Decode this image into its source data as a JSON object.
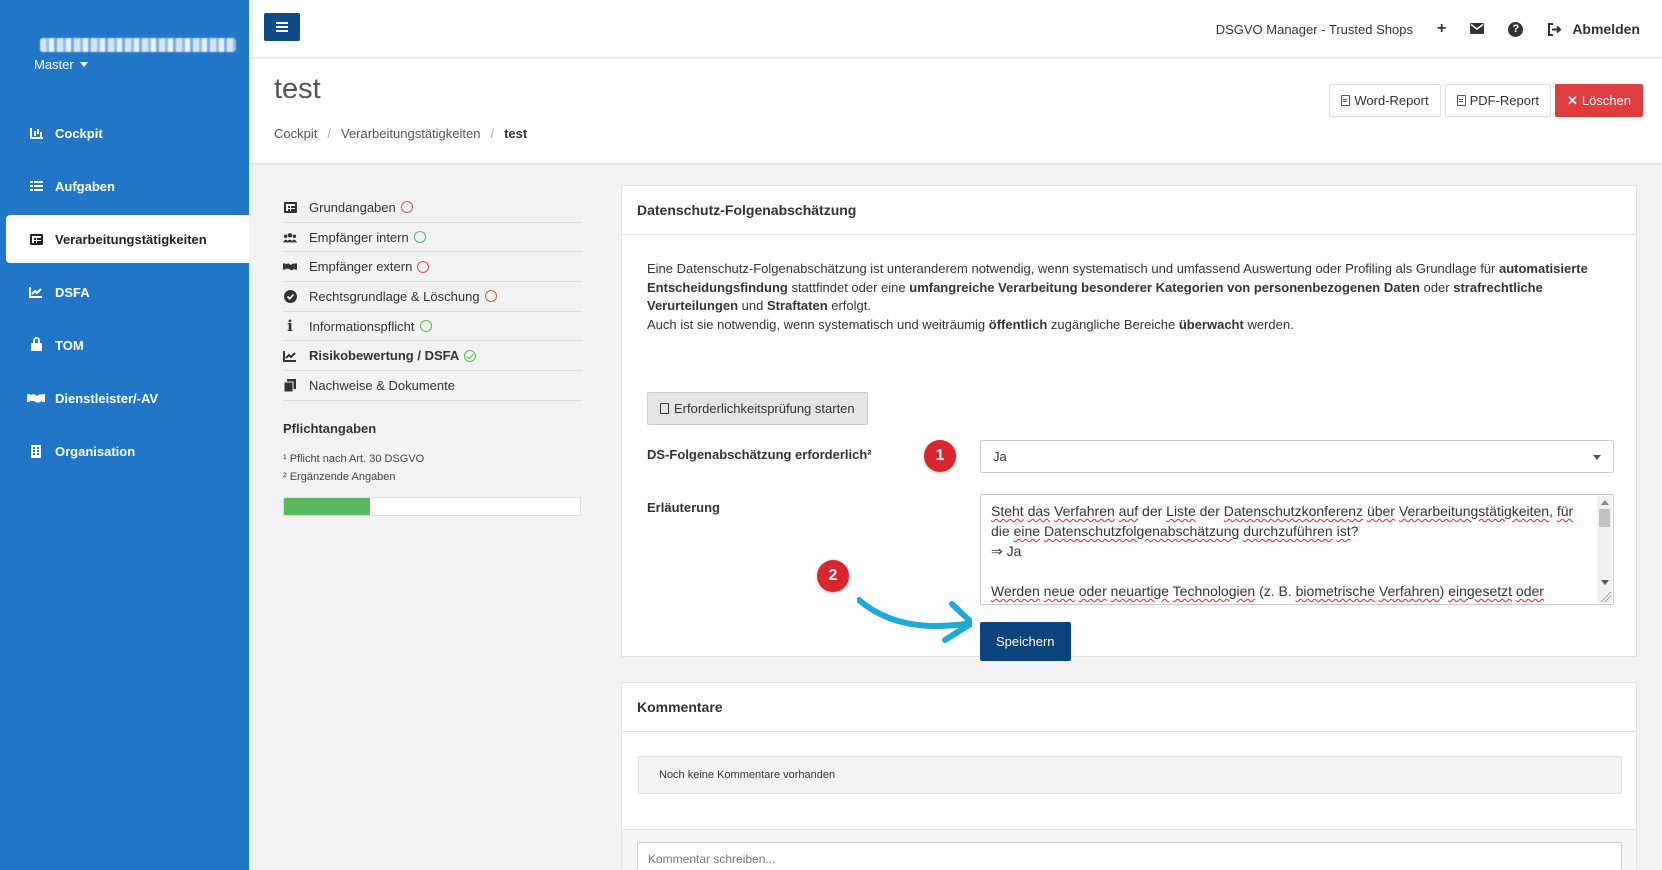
{
  "sidebar": {
    "user_label": "",
    "tenant": "Master",
    "items": [
      {
        "label": "Cockpit",
        "icon": "chart-icon"
      },
      {
        "label": "Aufgaben",
        "icon": "list-icon"
      },
      {
        "label": "Verarbeitungstätigkeiten",
        "icon": "table-icon",
        "active": true
      },
      {
        "label": "DSFA",
        "icon": "line-chart-icon"
      },
      {
        "label": "TOM",
        "icon": "lock-icon"
      },
      {
        "label": "Dienstleister/-AV",
        "icon": "handshake-icon"
      },
      {
        "label": "Organisation",
        "icon": "building-icon"
      }
    ]
  },
  "topbar": {
    "app_name": "DSGVO Manager - Trusted Shops",
    "logout_label": "Abmelden"
  },
  "header": {
    "title": "test",
    "breadcrumb": [
      "Cockpit",
      "Verarbeitungstätigkeiten",
      "test"
    ],
    "word_report_label": "Word-Report",
    "pdf_report_label": "PDF-Report",
    "delete_label": "Löschen"
  },
  "tabs": [
    {
      "label": "Grundangaben",
      "status": "red"
    },
    {
      "label": "Empfänger intern",
      "status": "green"
    },
    {
      "label": "Empfänger extern",
      "status": "red"
    },
    {
      "label": "Rechtsgrundlage & Löschung",
      "status": "red"
    },
    {
      "label": "Informationspflicht",
      "status": "green"
    },
    {
      "label": "Risikobewertung / DSFA",
      "status": "check"
    },
    {
      "label": "Nachweise & Dokumente",
      "status": "none"
    }
  ],
  "pflicht": {
    "title": "Pflichtangaben",
    "footnote1": "¹ Pflicht nach Art. 30 DSGVO",
    "footnote2": "² Ergänzende Angaben",
    "progress_fraction": 0.29
  },
  "dsfa": {
    "title": "Datenschutz-Folgenabschätzung",
    "intro": {
      "p1": "Eine Datenschutz-Folgenabschätzung ist unteranderem notwendig, wenn systematisch und umfassend Auswertung oder Profiling als Grundlage für ",
      "b1": "automatisierte Entscheidungsfindung",
      "p2": " stattfindet oder eine ",
      "b2": "umfangreiche Verarbeitung besonderer Kategorien von personenbezogenen Daten",
      "p3": " oder ",
      "b3": "strafrechtliche Verurteilungen",
      "p4": " und ",
      "b4": "Straftaten",
      "p5": " erfolgt.",
      "p6": "Auch ist sie notwendig, wenn systematisch und weiträumig ",
      "b5": "öffentlich",
      "p7": " zugängliche Bereiche ",
      "b6": "überwacht",
      "p8": " werden."
    },
    "check_button_label": "Erforderlichkeitsprüfung starten",
    "required_label": "DS-Folgenabschätzung erforderlich²",
    "required_value": "Ja",
    "explanation_label": "Erläuterung",
    "explanation_text": {
      "q1": "Steht das Verfahren auf der Liste der Datenschutzkonferenz über Verarbeitungstätigkeiten, für die eine Datenschutzfolgenabschätzung durchzuführen ist?",
      "a1": "⇒ Ja",
      "q2": "Werden neue oder neuartige Technologien (z. B. biometrische Verfahren) eingesetzt oder"
    },
    "save_label": "Speichern",
    "marker1": "1",
    "marker2": "2",
    "colors": {
      "marker": "#d8262f",
      "arrow": "#1fa8d8",
      "save": "#0c457d"
    }
  },
  "comments": {
    "title": "Kommentare",
    "empty_text": "Noch keine Kommentare vorhanden",
    "input_placeholder": "Kommentar schreiben..."
  }
}
